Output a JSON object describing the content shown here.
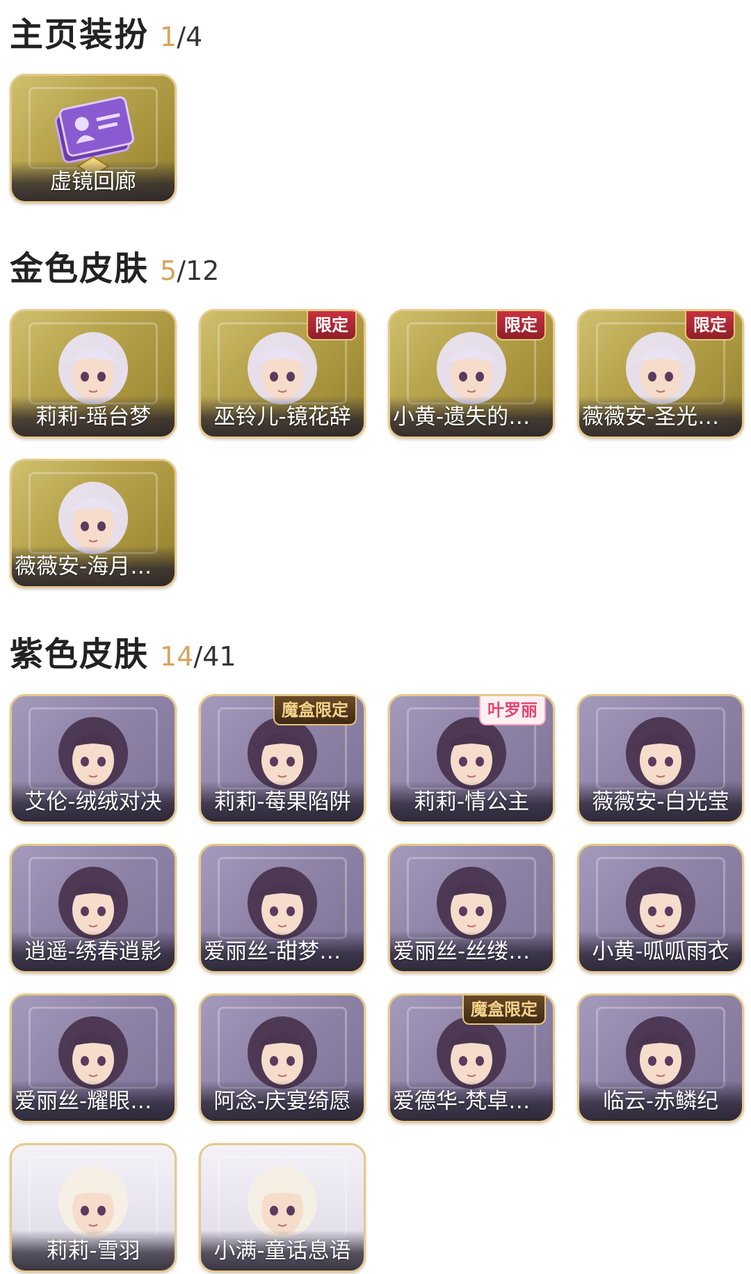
{
  "sections": [
    {
      "title": "主页装扮",
      "owned": "1",
      "total": "/4",
      "items": [
        {
          "label": "虚镜回廊",
          "tier": "gold",
          "badge": null,
          "icon": "card-icon"
        }
      ]
    },
    {
      "title": "金色皮肤",
      "owned": "5",
      "total": "/12",
      "items": [
        {
          "label": "莉莉-瑶台梦",
          "tier": "gold",
          "badge": null,
          "icon": "character-portrait"
        },
        {
          "label": "巫铃儿-镜花辞",
          "tier": "gold",
          "badge": "限定",
          "icon": "character-portrait"
        },
        {
          "label": "小黄-遗失的童...",
          "tier": "gold",
          "badge": "限定",
          "icon": "character-portrait"
        },
        {
          "label": "薇薇安-圣光之...",
          "tier": "gold",
          "badge": "限定",
          "icon": "character-portrait"
        },
        {
          "label": "薇薇安-海月息...",
          "tier": "gold",
          "badge": null,
          "icon": "character-portrait"
        }
      ]
    },
    {
      "title": "紫色皮肤",
      "owned": "14",
      "total": "/41",
      "items": [
        {
          "label": "艾伦-绒绒对决",
          "tier": "purple",
          "badge": null,
          "icon": "character-portrait"
        },
        {
          "label": "莉莉-莓果陷阱",
          "tier": "purple",
          "badge": "魔盒限定",
          "icon": "character-portrait"
        },
        {
          "label": "莉莉-情公主",
          "tier": "purple",
          "badge": "叶罗丽",
          "icon": "character-portrait"
        },
        {
          "label": "薇薇安-白光莹",
          "tier": "purple",
          "badge": null,
          "icon": "character-portrait"
        },
        {
          "label": "逍遥-绣春逍影",
          "tier": "purple",
          "badge": null,
          "icon": "character-portrait"
        },
        {
          "label": "爱丽丝-甜梦派...",
          "tier": "purple",
          "badge": null,
          "icon": "character-portrait"
        },
        {
          "label": "爱丽丝-丝缕哀...",
          "tier": "purple",
          "badge": null,
          "icon": "character-portrait"
        },
        {
          "label": "小黄-呱呱雨衣",
          "tier": "purple",
          "badge": null,
          "icon": "character-portrait"
        },
        {
          "label": "爱丽丝-耀眼的...",
          "tier": "purple",
          "badge": null,
          "icon": "character-portrait"
        },
        {
          "label": "阿念-庆宴绮愿",
          "tier": "purple",
          "badge": null,
          "icon": "character-portrait"
        },
        {
          "label": "爱德华-梵卓之...",
          "tier": "purple",
          "badge": "魔盒限定",
          "icon": "character-portrait"
        },
        {
          "label": "临云-赤鳞纪",
          "tier": "purple",
          "badge": null,
          "icon": "character-portrait"
        },
        {
          "label": "莉莉-雪羽",
          "tier": "plain",
          "badge": null,
          "icon": "character-portrait"
        },
        {
          "label": "小满-童话息语",
          "tier": "plain",
          "badge": null,
          "icon": "character-portrait"
        }
      ]
    }
  ],
  "colors": {
    "accent_count": "#d8a35a",
    "title": "#222222",
    "card_border": "#e6c989",
    "gold_tier": "#b9a64f",
    "purple_tier": "#8f84a8"
  }
}
